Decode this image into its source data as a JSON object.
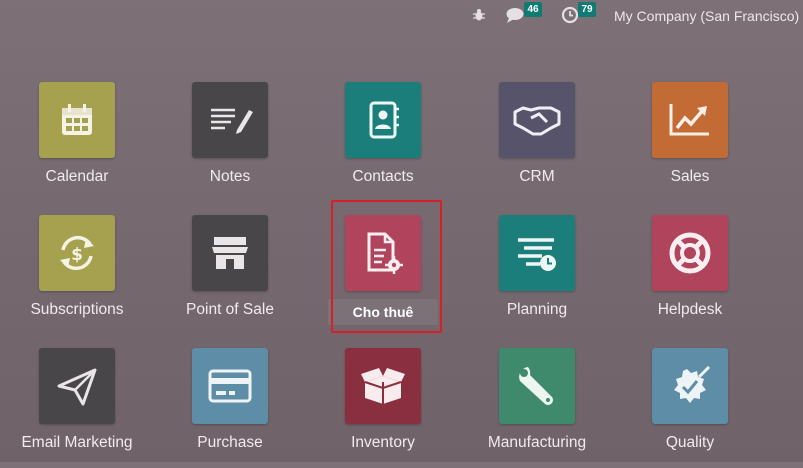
{
  "topbar": {
    "messages_count": "46",
    "activities_count": "79",
    "company": "My Company (San Francisco)"
  },
  "icon_names": {
    "debug": "bug-icon",
    "messages": "chat-icon",
    "activities": "clock-icon"
  },
  "apps": [
    {
      "label": "Calendar",
      "icon": "calendar-icon",
      "color": "#a5a14e"
    },
    {
      "label": "Notes",
      "icon": "notes-icon",
      "color": "#494649"
    },
    {
      "label": "Contacts",
      "icon": "contacts-icon",
      "color": "#1b7e7a"
    },
    {
      "label": "CRM",
      "icon": "handshake-icon",
      "color": "#56536a"
    },
    {
      "label": "Sales",
      "icon": "chart-icon",
      "color": "#c36b35"
    },
    {
      "label": "Subscriptions",
      "icon": "subscriptions-icon",
      "color": "#a5a14e"
    },
    {
      "label": "Point of Sale",
      "icon": "store-icon",
      "color": "#494649"
    },
    {
      "label": "Cho thuê",
      "icon": "rental-document-gear-icon",
      "color": "#b0445d",
      "selected": true
    },
    {
      "label": "Planning",
      "icon": "planning-icon",
      "color": "#1b7e7a"
    },
    {
      "label": "Helpdesk",
      "icon": "lifebuoy-icon",
      "color": "#b0445d"
    },
    {
      "label": "Email Marketing",
      "icon": "paper-plane-icon",
      "color": "#494649"
    },
    {
      "label": "Purchase",
      "icon": "credit-card-icon",
      "color": "#5e8da8"
    },
    {
      "label": "Inventory",
      "icon": "box-icon",
      "color": "#8a2f3f"
    },
    {
      "label": "Manufacturing",
      "icon": "wrench-icon",
      "color": "#3f8a6c"
    },
    {
      "label": "Quality",
      "icon": "quality-badge-icon",
      "color": "#5e8da8"
    }
  ]
}
